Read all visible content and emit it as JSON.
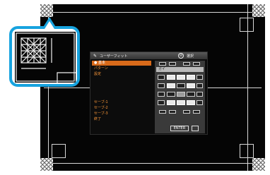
{
  "osd": {
    "title": "ユーザーフィット",
    "exit_label": "選択",
    "menu_items": [
      "● 基本",
      "パターン",
      "設定",
      "",
      "",
      "",
      "",
      "セーブ-1",
      "セーブ-2",
      "セーブ-3",
      "終了"
    ],
    "panel_label": "ガイ",
    "enter_label": "ENTER"
  },
  "colors": {
    "accent": "#17a3df",
    "menu_text": "#ff9a3a",
    "menu_selected": "#d86a1a"
  }
}
